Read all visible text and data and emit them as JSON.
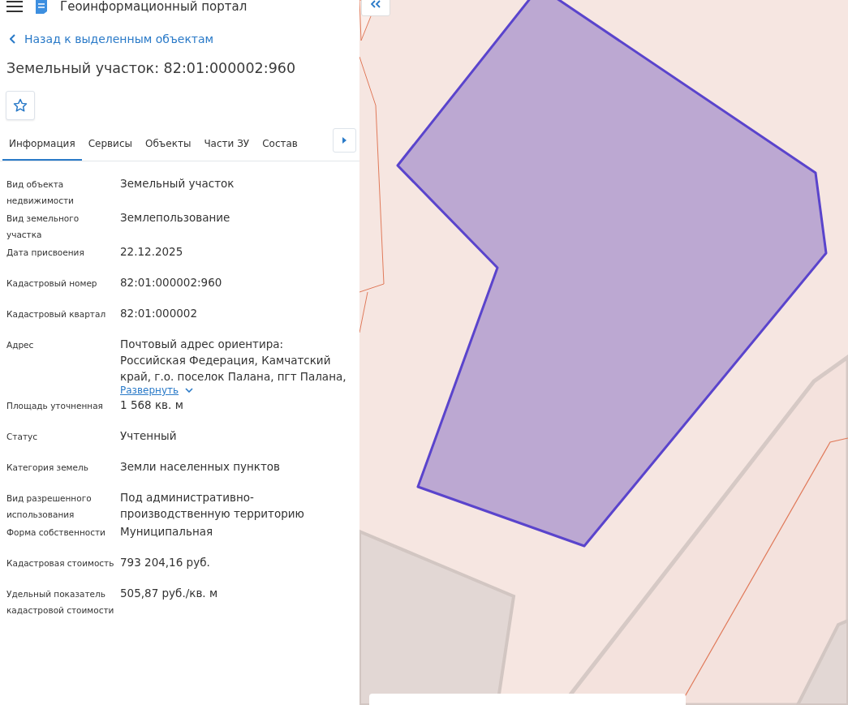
{
  "header": {
    "title": "Геоинформационный портал"
  },
  "back_link": "Назад к выделенным объектам",
  "object_title": "Земельный участок: 82:01:000002:960",
  "favorite": {
    "on": false
  },
  "tabs": [
    {
      "label": "Информация",
      "selected": true
    },
    {
      "label": "Сервисы",
      "selected": false
    },
    {
      "label": "Объекты",
      "selected": false
    },
    {
      "label": "Части ЗУ",
      "selected": false
    },
    {
      "label": "Состав",
      "selected": false
    }
  ],
  "properties": [
    {
      "label": "Вид объекта недвижимости",
      "value": "Земельный участок"
    },
    {
      "label": "Вид земельного участка",
      "value": "Землепользование"
    },
    {
      "label": "Дата присвоения",
      "value": "22.12.2025"
    },
    {
      "label": "Кадастровый номер",
      "value": "82:01:000002:960"
    },
    {
      "label": "Кадастровый квартал",
      "value": "82:01:000002"
    },
    {
      "label": "Адрес",
      "value": "Почтовый адрес ориентира: Российская Федерация, Камчатский край, г.о. поселок Палана, пгт Палана,",
      "expand_link": "Развернуть"
    },
    {
      "label": "Площадь уточненная",
      "value": "1 568 кв. м"
    },
    {
      "label": "Статус",
      "value": "Учтенный"
    },
    {
      "label": "Категория земель",
      "value": "Земли населенных пунктов"
    },
    {
      "label": "Вид разрешенного использования",
      "value": "Под административно-производственную территорию"
    },
    {
      "label": "Форма собственности",
      "value": "Муниципальная"
    },
    {
      "label": "Кадастровая стоимость",
      "value": "793 204,16 руб."
    },
    {
      "label": "Удельный показатель кадастровой стоимости",
      "value": "505,87 руб./кв. м"
    }
  ]
}
